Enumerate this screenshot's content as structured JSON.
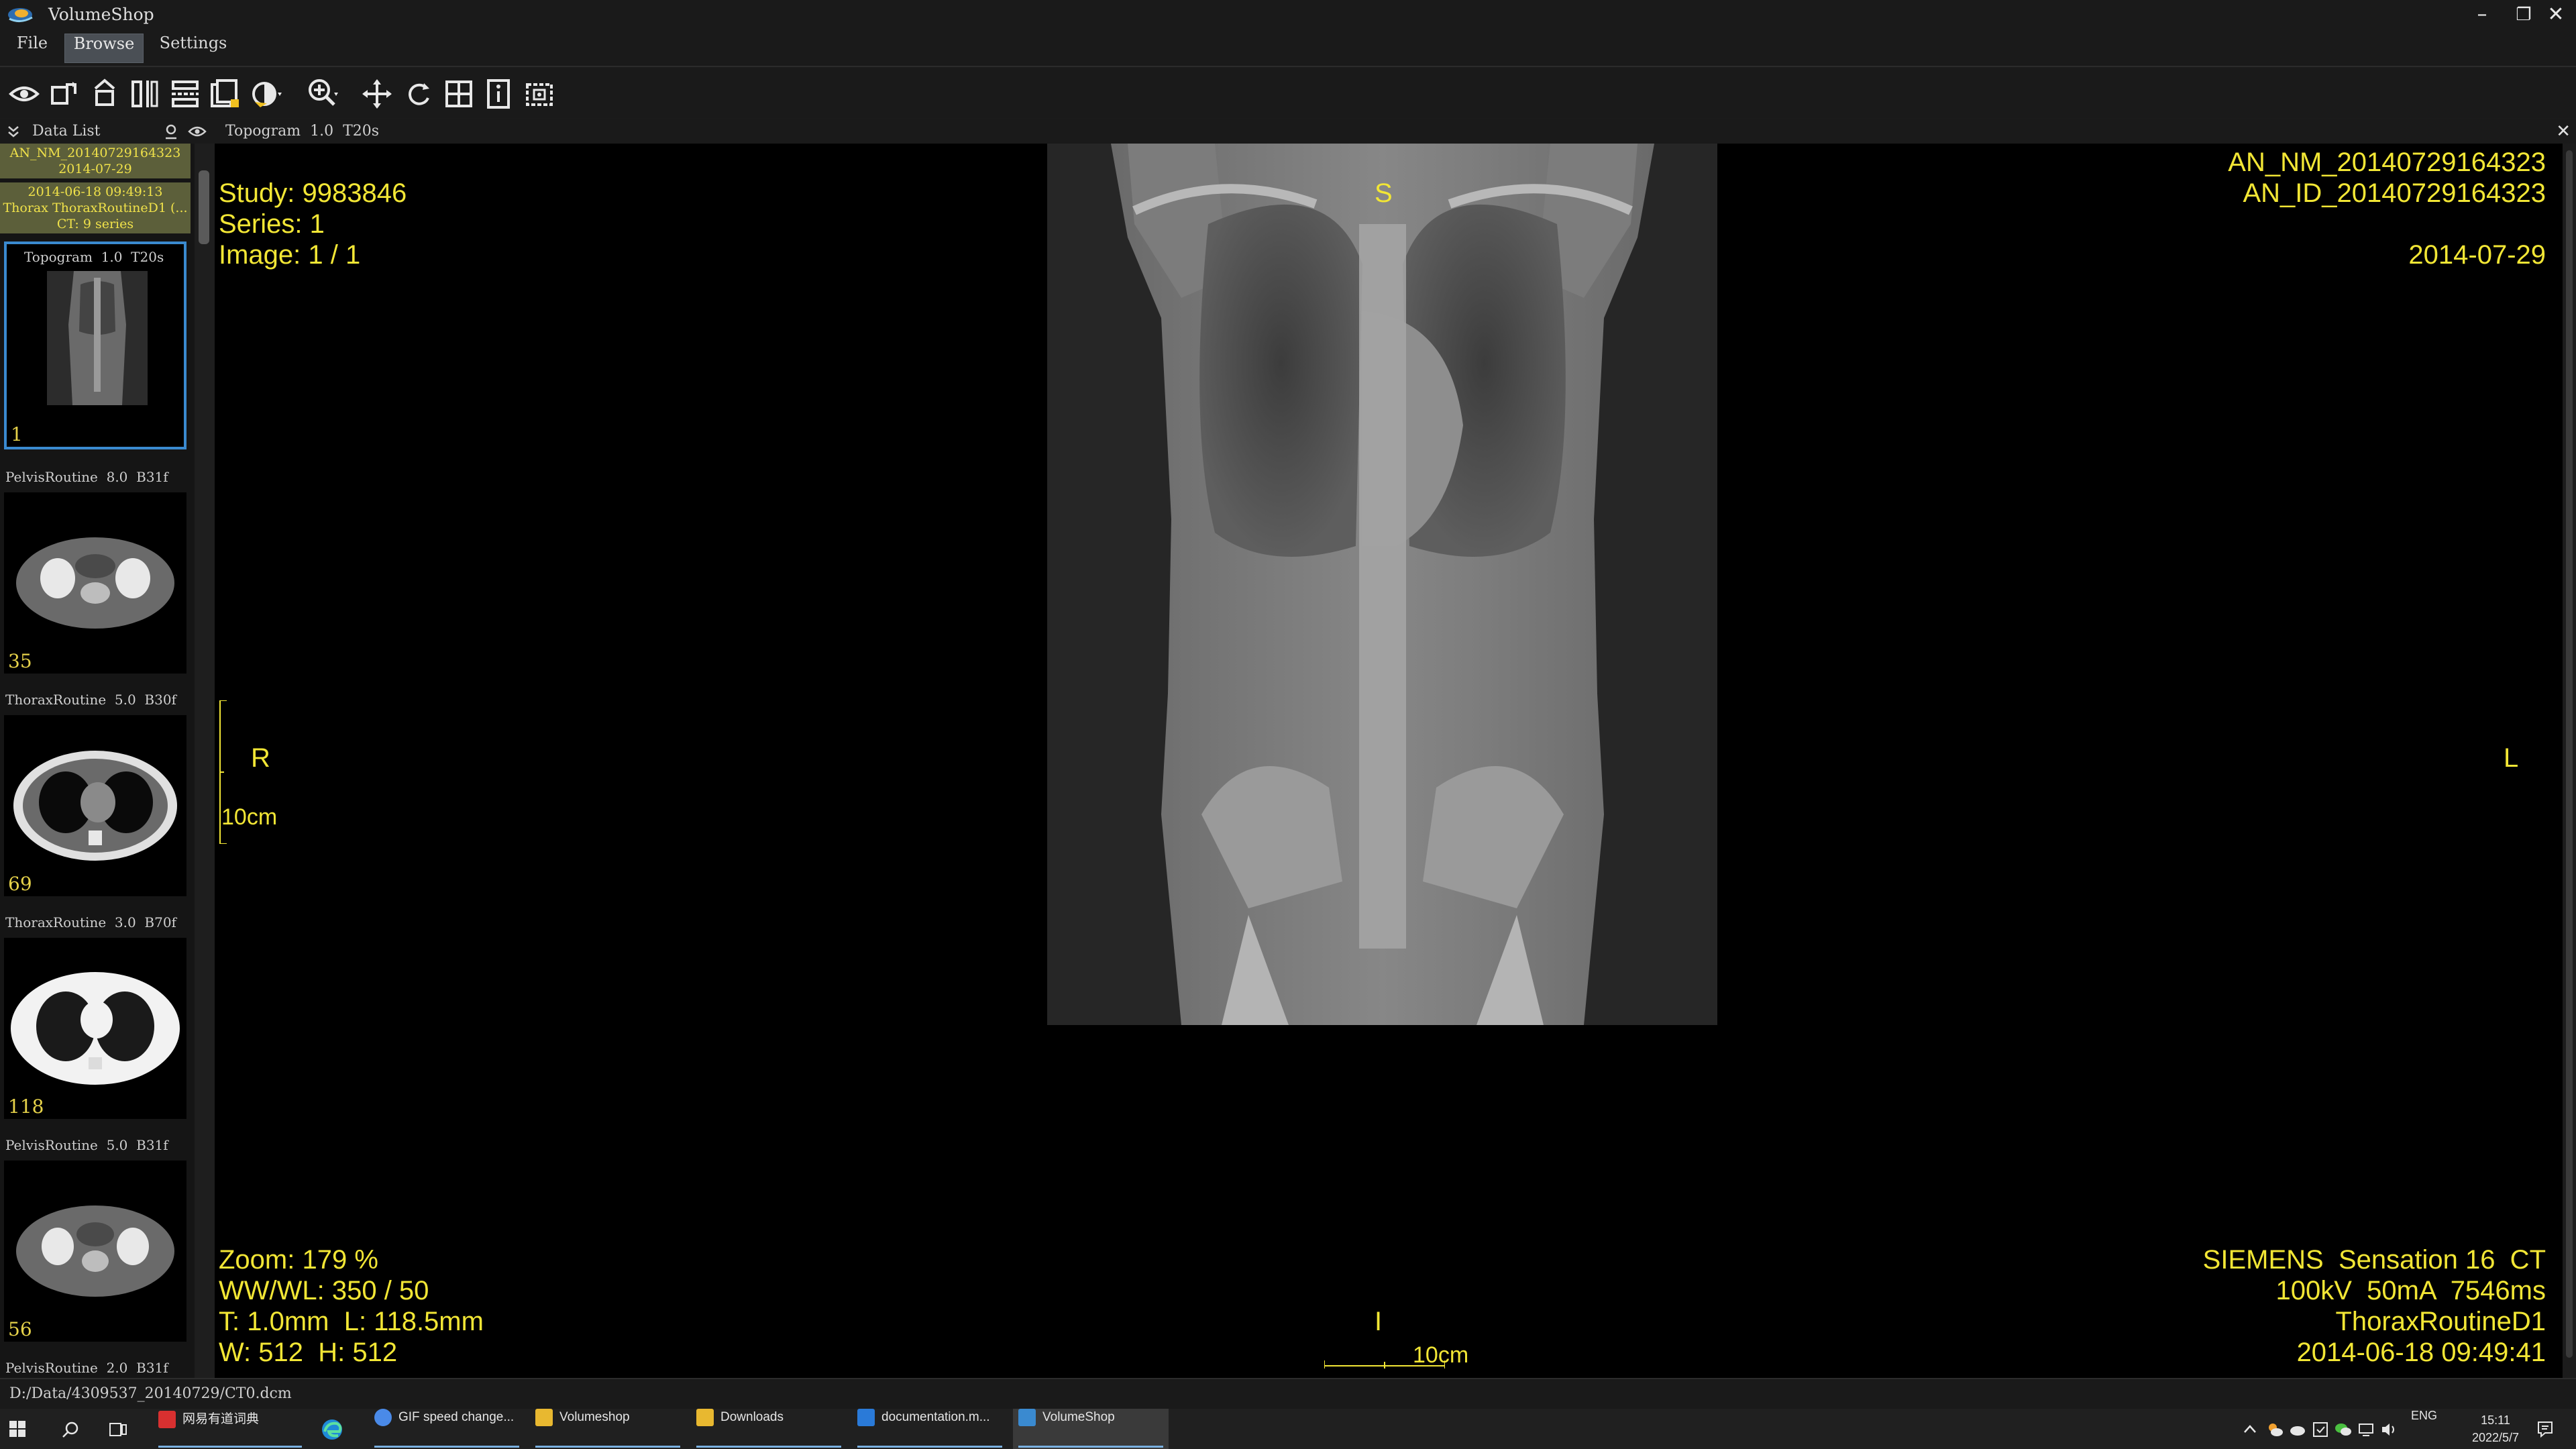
{
  "window": {
    "title": "VolumeShop",
    "minimize": "–",
    "maximize": "❐",
    "close": "✕"
  },
  "menu": {
    "items": [
      "File",
      "Browse",
      "Settings"
    ],
    "active": "Browse"
  },
  "toolbar": {
    "tools": [
      "eye-icon",
      "rotate-icon",
      "flip-icon",
      "split-vertical-icon",
      "split-horizontal-icon",
      "stack-icon",
      "contrast-icon",
      "zoom-icon",
      "pan-icon",
      "reset-icon",
      "grid-icon",
      "info-icon",
      "screenshot-icon"
    ]
  },
  "data_list": {
    "label": "Data List"
  },
  "viewer_header": {
    "label": "Topogram  1.0  T20s",
    "close": "✕"
  },
  "patient": {
    "line1": "AN_NM_20140729164323",
    "line2": "2014-07-29",
    "study_line1": "2014-06-18 09:49:13",
    "study_line2": "Thorax ThoraxRoutineD1 (...",
    "study_line3": "CT: 9 series"
  },
  "series": [
    {
      "title": "Topogram  1.0  T20s",
      "count": "1"
    },
    {
      "title": "PelvisRoutine  8.0  B31f",
      "count": "35"
    },
    {
      "title": "ThoraxRoutine  5.0  B30f",
      "count": "69"
    },
    {
      "title": "ThoraxRoutine  3.0  B70f",
      "count": "118"
    },
    {
      "title": "PelvisRoutine  5.0  B31f",
      "count": "56"
    },
    {
      "title": "PelvisRoutine  2.0  B31f",
      "count": ""
    }
  ],
  "overlay": {
    "top_left": {
      "study": "Study: 9983846",
      "series": "Series: 1",
      "image": "Image: 1 / 1"
    },
    "top_right": {
      "name": "AN_NM_20140729164323",
      "id": "AN_ID_20140729164323",
      "date": "2014-07-29"
    },
    "orientation": {
      "top": "S",
      "bottom": "I",
      "left": "R",
      "right": "L"
    },
    "scale_vertical": "10cm",
    "scale_horizontal": "10cm",
    "bottom_left": {
      "zoom": "Zoom: 179 %",
      "window": "WW/WL: 350 / 50",
      "thickness": "T: 1.0mm  L: 118.5mm",
      "size": "W: 512  H: 512"
    },
    "bottom_right": {
      "scanner": "SIEMENS  Sensation 16  CT",
      "params": "100kV  50mA  7546ms",
      "protocol": "ThoraxRoutineD1",
      "datetime": "2014-06-18 09:49:41"
    }
  },
  "status": {
    "path": "D:/Data/4309537_20140729/CT0.dcm"
  },
  "taskbar": {
    "items": [
      {
        "label": "网易有道词典",
        "color": "#d83030"
      },
      {
        "label": "GIF speed change...",
        "color": "#4a8ae8"
      },
      {
        "label": "Volumeshop",
        "color": "#e8b830"
      },
      {
        "label": "Downloads",
        "color": "#e8b830"
      },
      {
        "label": "documentation.m...",
        "color": "#2a7ad8"
      },
      {
        "label": "VolumeShop",
        "color": "#3a8ad0"
      }
    ],
    "lang": "ENG",
    "time": "15:11",
    "date": "2022/5/7"
  }
}
